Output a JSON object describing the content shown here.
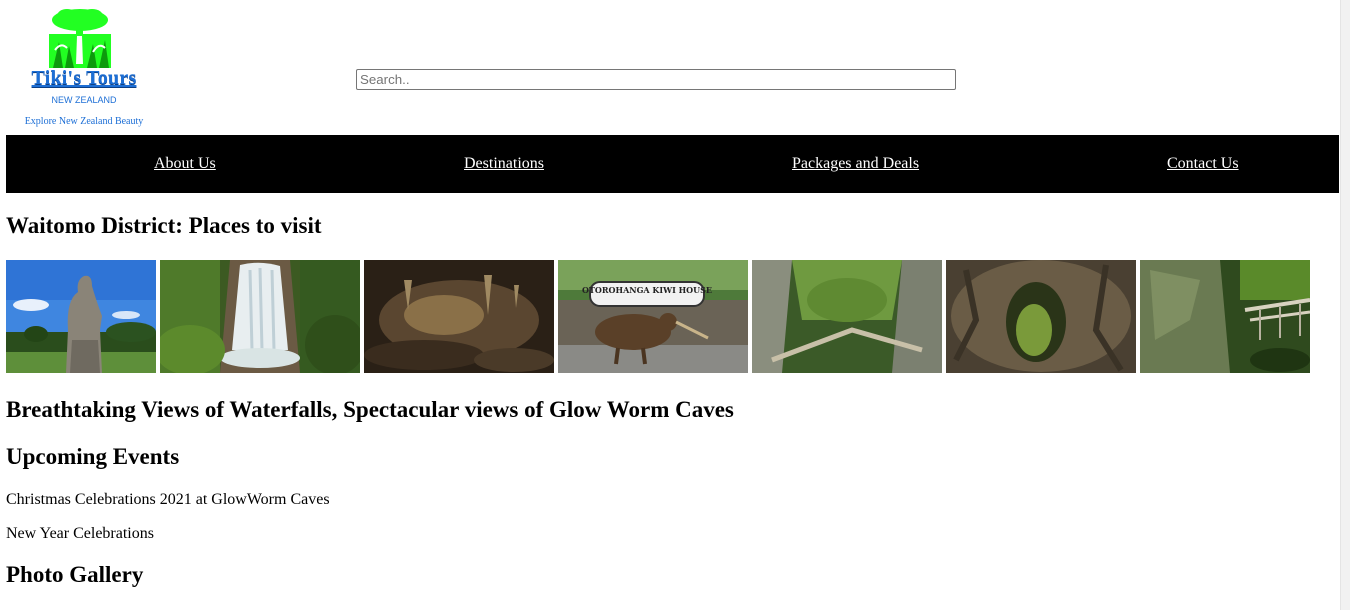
{
  "logo": {
    "title": "Tiki's Tours",
    "subtitle": "NEW ZEALAND",
    "tagline": "Explore New Zealand Beauty",
    "icon": "tree-icon",
    "brand_color": "#1d6fd6",
    "icon_color": "#1fff1f"
  },
  "search": {
    "placeholder": "Search..",
    "value": ""
  },
  "nav": {
    "background": "#000000",
    "items": [
      {
        "label": "About Us"
      },
      {
        "label": "Destinations"
      },
      {
        "label": "Packages and Deals"
      },
      {
        "label": "Contact Us"
      }
    ]
  },
  "main": {
    "places_heading": "Waitomo District: Places to visit",
    "photos": [
      {
        "subject": "statue"
      },
      {
        "subject": "waterfall"
      },
      {
        "subject": "cave"
      },
      {
        "subject": "kiwi-house-sign",
        "sign_text": "OTOROHANGA KIWI HOUSE"
      },
      {
        "subject": "gorge-walkway"
      },
      {
        "subject": "limestone-tunnel"
      },
      {
        "subject": "bridge-gorge"
      }
    ],
    "views_heading": "Breathtaking Views of Waterfalls, Spectacular views of Glow Worm Caves",
    "events_heading": "Upcoming Events",
    "events": [
      "Christmas Celebrations 2021 at GlowWorm Caves",
      "New Year Celebrations"
    ],
    "gallery_heading": "Photo Gallery"
  }
}
